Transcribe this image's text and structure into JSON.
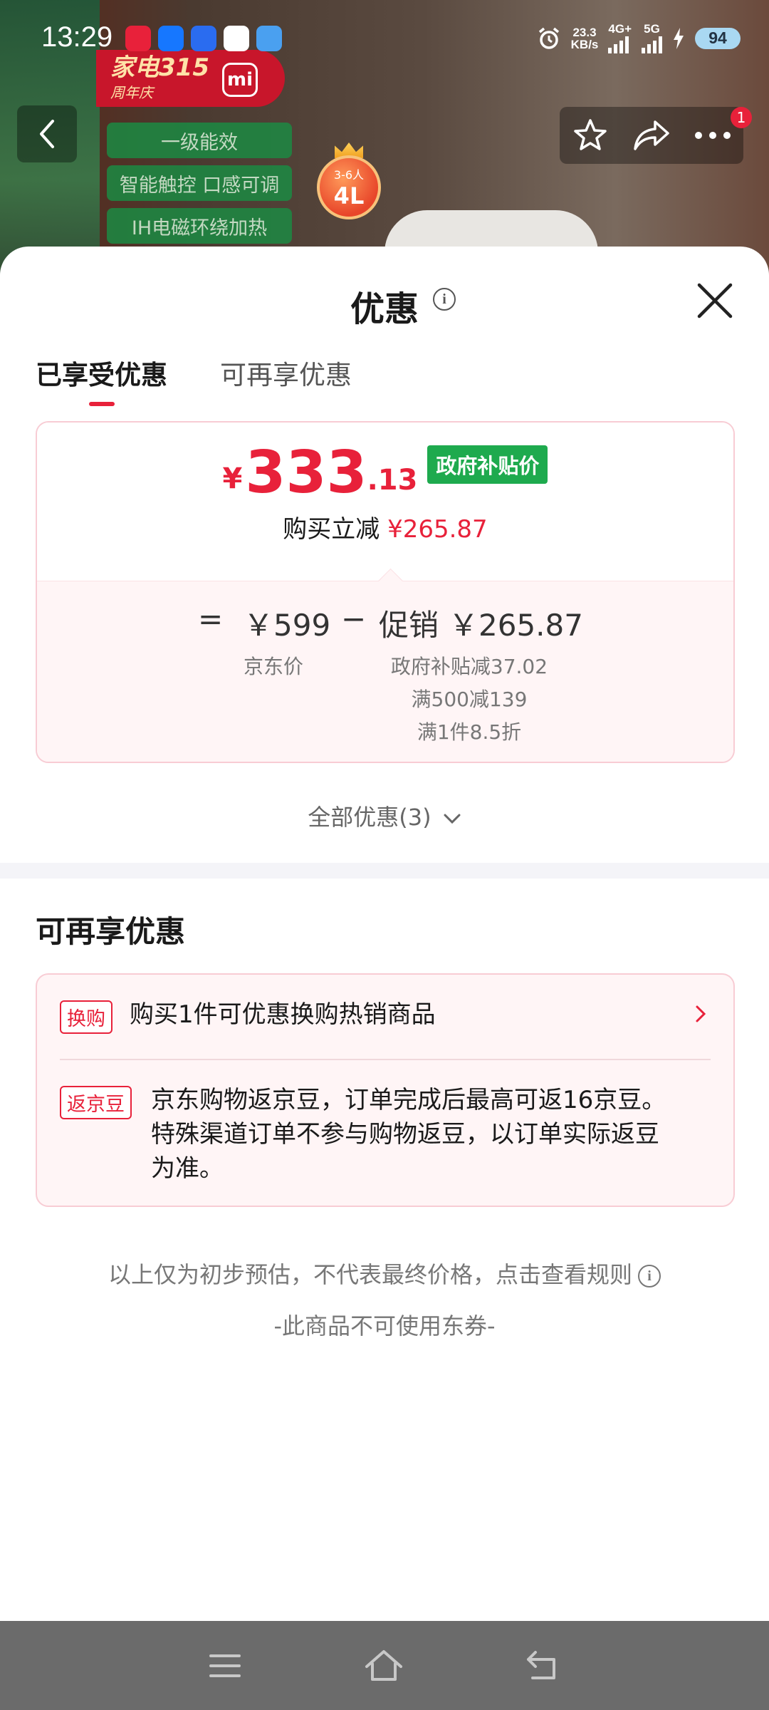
{
  "status_bar": {
    "time": "13:29",
    "speed_value": "23.3",
    "speed_unit": "KB/s",
    "net1": "4G+",
    "net2": "5G",
    "battery": "94"
  },
  "backdrop": {
    "banner_line1": "家电315",
    "banner_line2": "周年庆",
    "brand_logo": "mi",
    "tags": [
      "一级能效",
      "智能触控  口感可调",
      "IH电磁环绕加热"
    ],
    "badge_people": "3-6人",
    "badge_volume": "4L",
    "notification_count": "1"
  },
  "sheet": {
    "title": "优惠",
    "tabs": [
      {
        "label": "已享受优惠",
        "active": true
      },
      {
        "label": "可再享优惠",
        "active": false
      }
    ],
    "price": {
      "currency": "¥",
      "integer": "333",
      "decimal": ".13",
      "tag": "政府补贴价",
      "save_label": "购买立减",
      "save_amount": "¥265.87"
    },
    "formula": {
      "equals": "=",
      "base_price": "￥599",
      "base_label": "京东价",
      "minus": "−",
      "promo_label": "促销",
      "promo_amount": "￥265.87",
      "promo_items": [
        "政府补贴减37.02",
        "满500减139",
        "满1件8.5折"
      ]
    },
    "all_deals": "全部优惠(3)",
    "more_section": {
      "title": "可再享优惠",
      "items": [
        {
          "tag": "换购",
          "text": "购买1件可优惠换购热销商品"
        },
        {
          "tag": "返京豆",
          "lines": [
            "京东购物返京豆，订单完成后最高可返16京豆。",
            "特殊渠道订单不参与购物返豆，以订单实际返豆",
            "为准。"
          ]
        }
      ]
    },
    "footer_note": "以上仅为初步预估，不代表最终价格，点击查看规则",
    "footer_coupon": "-此商品不可使用东券-"
  },
  "colors": {
    "accent_red": "#e8213a",
    "subsidy_green": "#1eaa4e",
    "card_border": "#f8ccd4",
    "card_bg": "#fff5f6"
  }
}
